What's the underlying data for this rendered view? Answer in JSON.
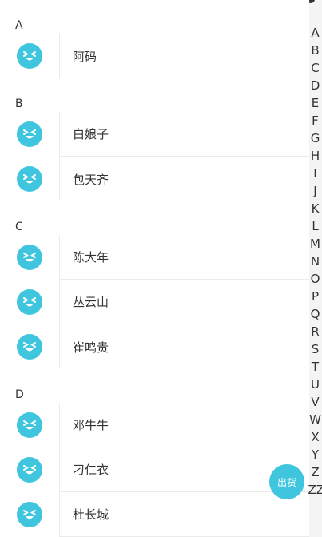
{
  "sections": [
    {
      "letter": "A",
      "contacts": [
        "阿码"
      ]
    },
    {
      "letter": "B",
      "contacts": [
        "白娘子",
        "包天齐"
      ]
    },
    {
      "letter": "C",
      "contacts": [
        "陈大年",
        "丛云山",
        "崔鸣贵"
      ]
    },
    {
      "letter": "D",
      "contacts": [
        "邓牛牛",
        "刁仁衣",
        "杜长城"
      ]
    }
  ],
  "index_letters": [
    "A",
    "B",
    "C",
    "D",
    "E",
    "F",
    "G",
    "H",
    "I",
    "J",
    "K",
    "L",
    "M",
    "N",
    "O",
    "P",
    "Q",
    "R",
    "S",
    "T",
    "U",
    "V",
    "W",
    "X",
    "Y",
    "Z",
    "ZZ"
  ],
  "fab": {
    "label": "出货"
  },
  "colors": {
    "accent": "#3fc6de",
    "divider": "#ebebeb"
  },
  "avatar_icon": "laughing-face-icon"
}
